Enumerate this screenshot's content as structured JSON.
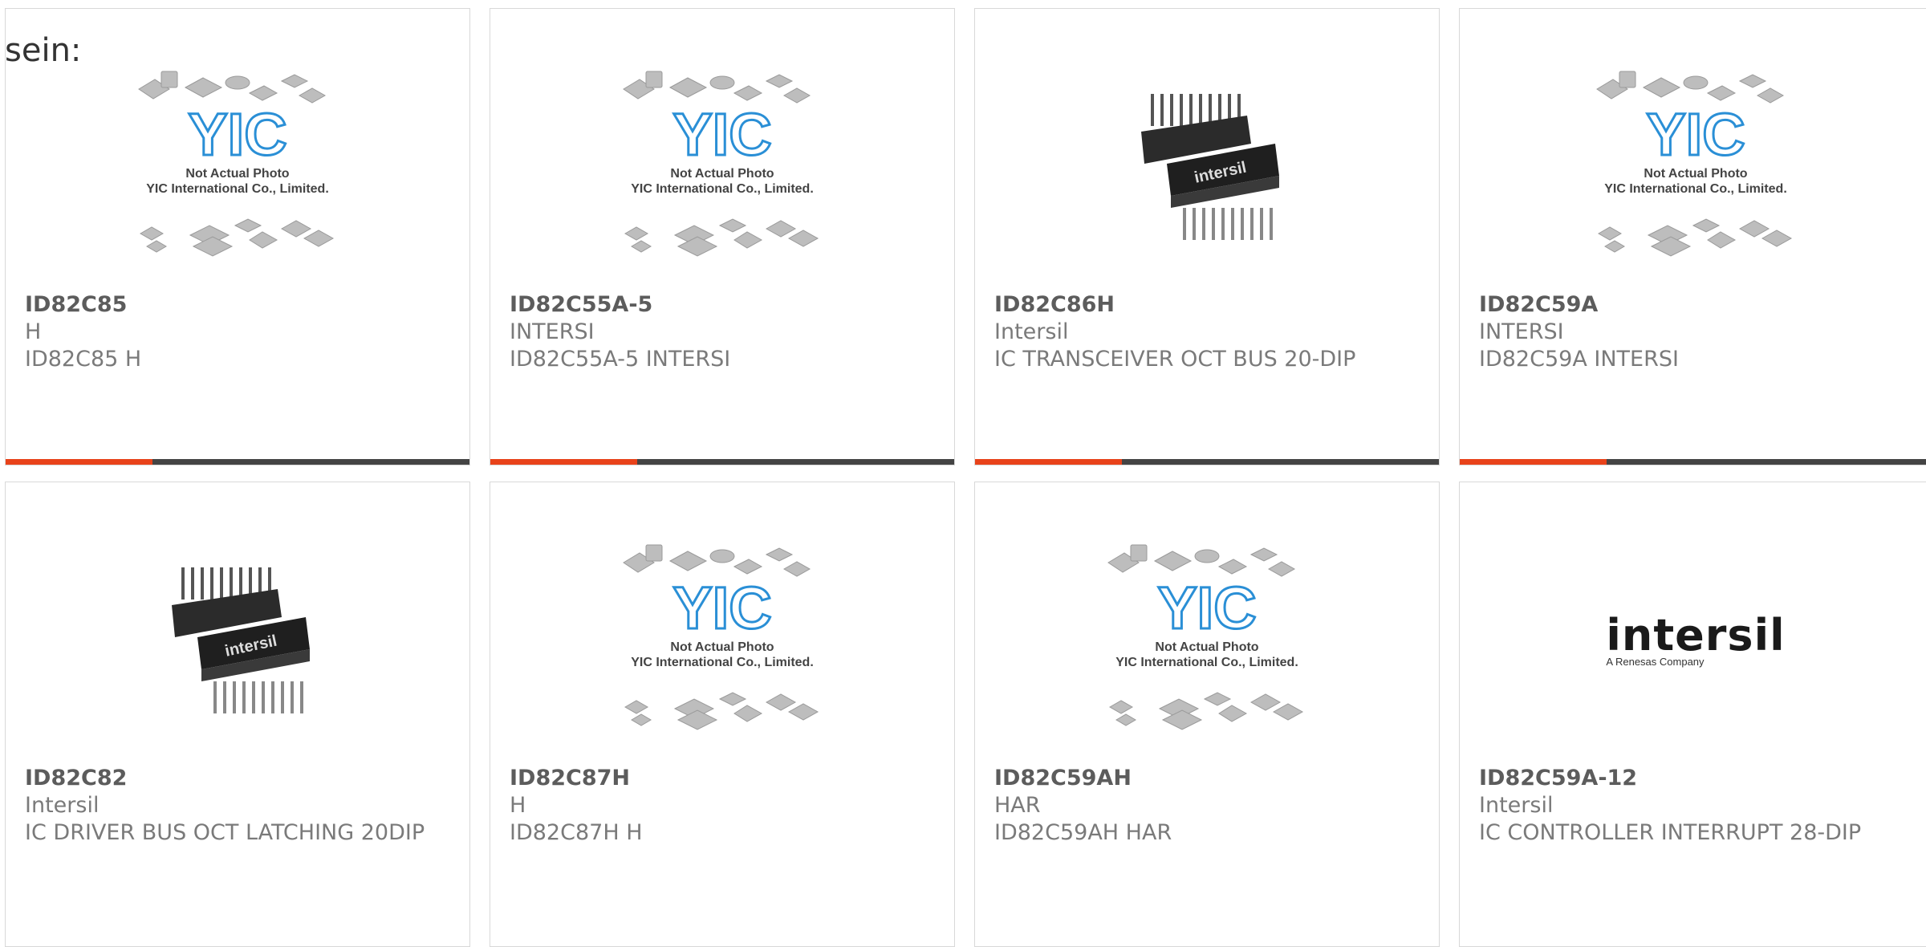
{
  "section_label": "sein:",
  "placeholder_text": {
    "line1": "Not Actual Photo",
    "line2": "YIC International Co., Limited.",
    "logo": "YIC"
  },
  "colors": {
    "accent": "#e8421a",
    "bar": "#444444",
    "text": "#7a7a7a"
  },
  "products": [
    {
      "part": "ID82C85",
      "brand": "H",
      "desc": "ID82C85 H",
      "image": "yic-placeholder"
    },
    {
      "part": "ID82C55A-5",
      "brand": "INTERSI",
      "desc": "ID82C55A-5 INTERSI",
      "image": "yic-placeholder"
    },
    {
      "part": "ID82C86H",
      "brand": "Intersil",
      "desc": "IC TRANSCEIVER OCT BUS 20-DIP",
      "image": "dip-chip-photo"
    },
    {
      "part": "ID82C59A",
      "brand": "INTERSI",
      "desc": "ID82C59A INTERSI",
      "image": "yic-placeholder"
    },
    {
      "part": "ID82C82",
      "brand": "Intersil",
      "desc": "IC DRIVER BUS OCT LATCHING 20DIP",
      "image": "dip-chip-photo"
    },
    {
      "part": "ID82C87H",
      "brand": "H",
      "desc": "ID82C87H H",
      "image": "yic-placeholder"
    },
    {
      "part": "ID82C59AH",
      "brand": "HAR",
      "desc": "ID82C59AH HAR",
      "image": "yic-placeholder"
    },
    {
      "part": "ID82C59A-12",
      "brand": "Intersil",
      "desc": "IC CONTROLLER INTERRUPT 28-DIP",
      "image": "intersil-logo",
      "logo_text": "intersil",
      "logo_sub": "A Renesas Company"
    }
  ]
}
